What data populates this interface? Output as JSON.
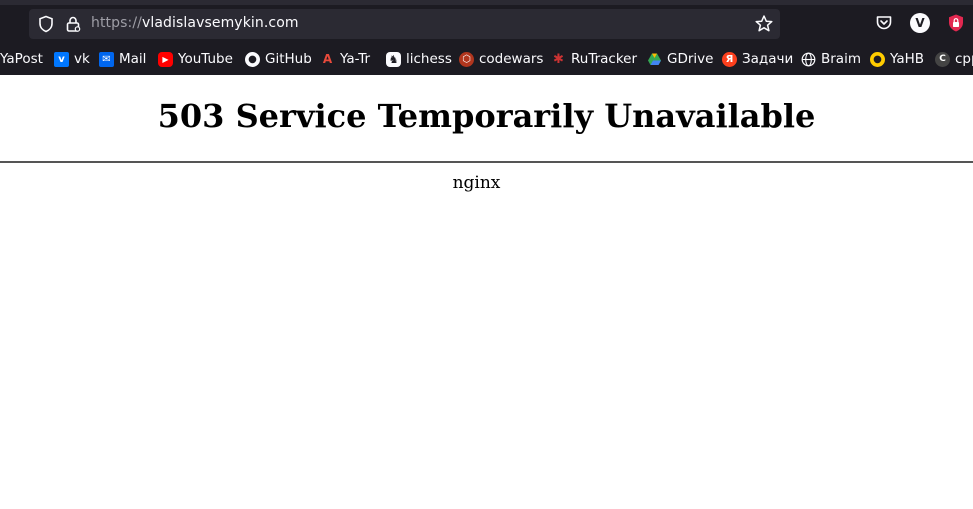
{
  "browser": {
    "url_protocol": "https://",
    "url_host": "vladislavsemykin.com",
    "profile_initial": "V",
    "bookmarks": [
      {
        "label": "YaPost",
        "icon": "none"
      },
      {
        "label": "vk",
        "icon": "vk-icon",
        "color": "#0077ff"
      },
      {
        "label": "Mail",
        "icon": "mail-icon",
        "color": "#0066ee"
      },
      {
        "label": "YouTube",
        "icon": "youtube-icon",
        "color": "#ff0000"
      },
      {
        "label": "GitHub",
        "icon": "github-icon",
        "color": "#ffffff"
      },
      {
        "label": "Ya-Tr",
        "icon": "translate-icon",
        "color": "#e84a3b"
      },
      {
        "label": "lichess",
        "icon": "lichess-icon",
        "color": "#ffffff"
      },
      {
        "label": "codewars",
        "icon": "codewars-icon",
        "color": "#b1361e"
      },
      {
        "label": "RuTracker",
        "icon": "rutracker-icon",
        "color": "#cc3333"
      },
      {
        "label": "GDrive",
        "icon": "gdrive-icon",
        "color": "#34a853"
      },
      {
        "label": "Задачи",
        "icon": "yandex-icon",
        "color": "#fc3f1d"
      },
      {
        "label": "Braim",
        "icon": "globe-icon",
        "color": "#ffffff"
      },
      {
        "label": "YaHB",
        "icon": "yahb-icon",
        "color": "#ffcc00"
      },
      {
        "label": "cpp",
        "icon": "cpp-icon",
        "color": "#444444"
      }
    ]
  },
  "page": {
    "title": "503 Service Temporarily Unavailable",
    "server": "nginx"
  }
}
